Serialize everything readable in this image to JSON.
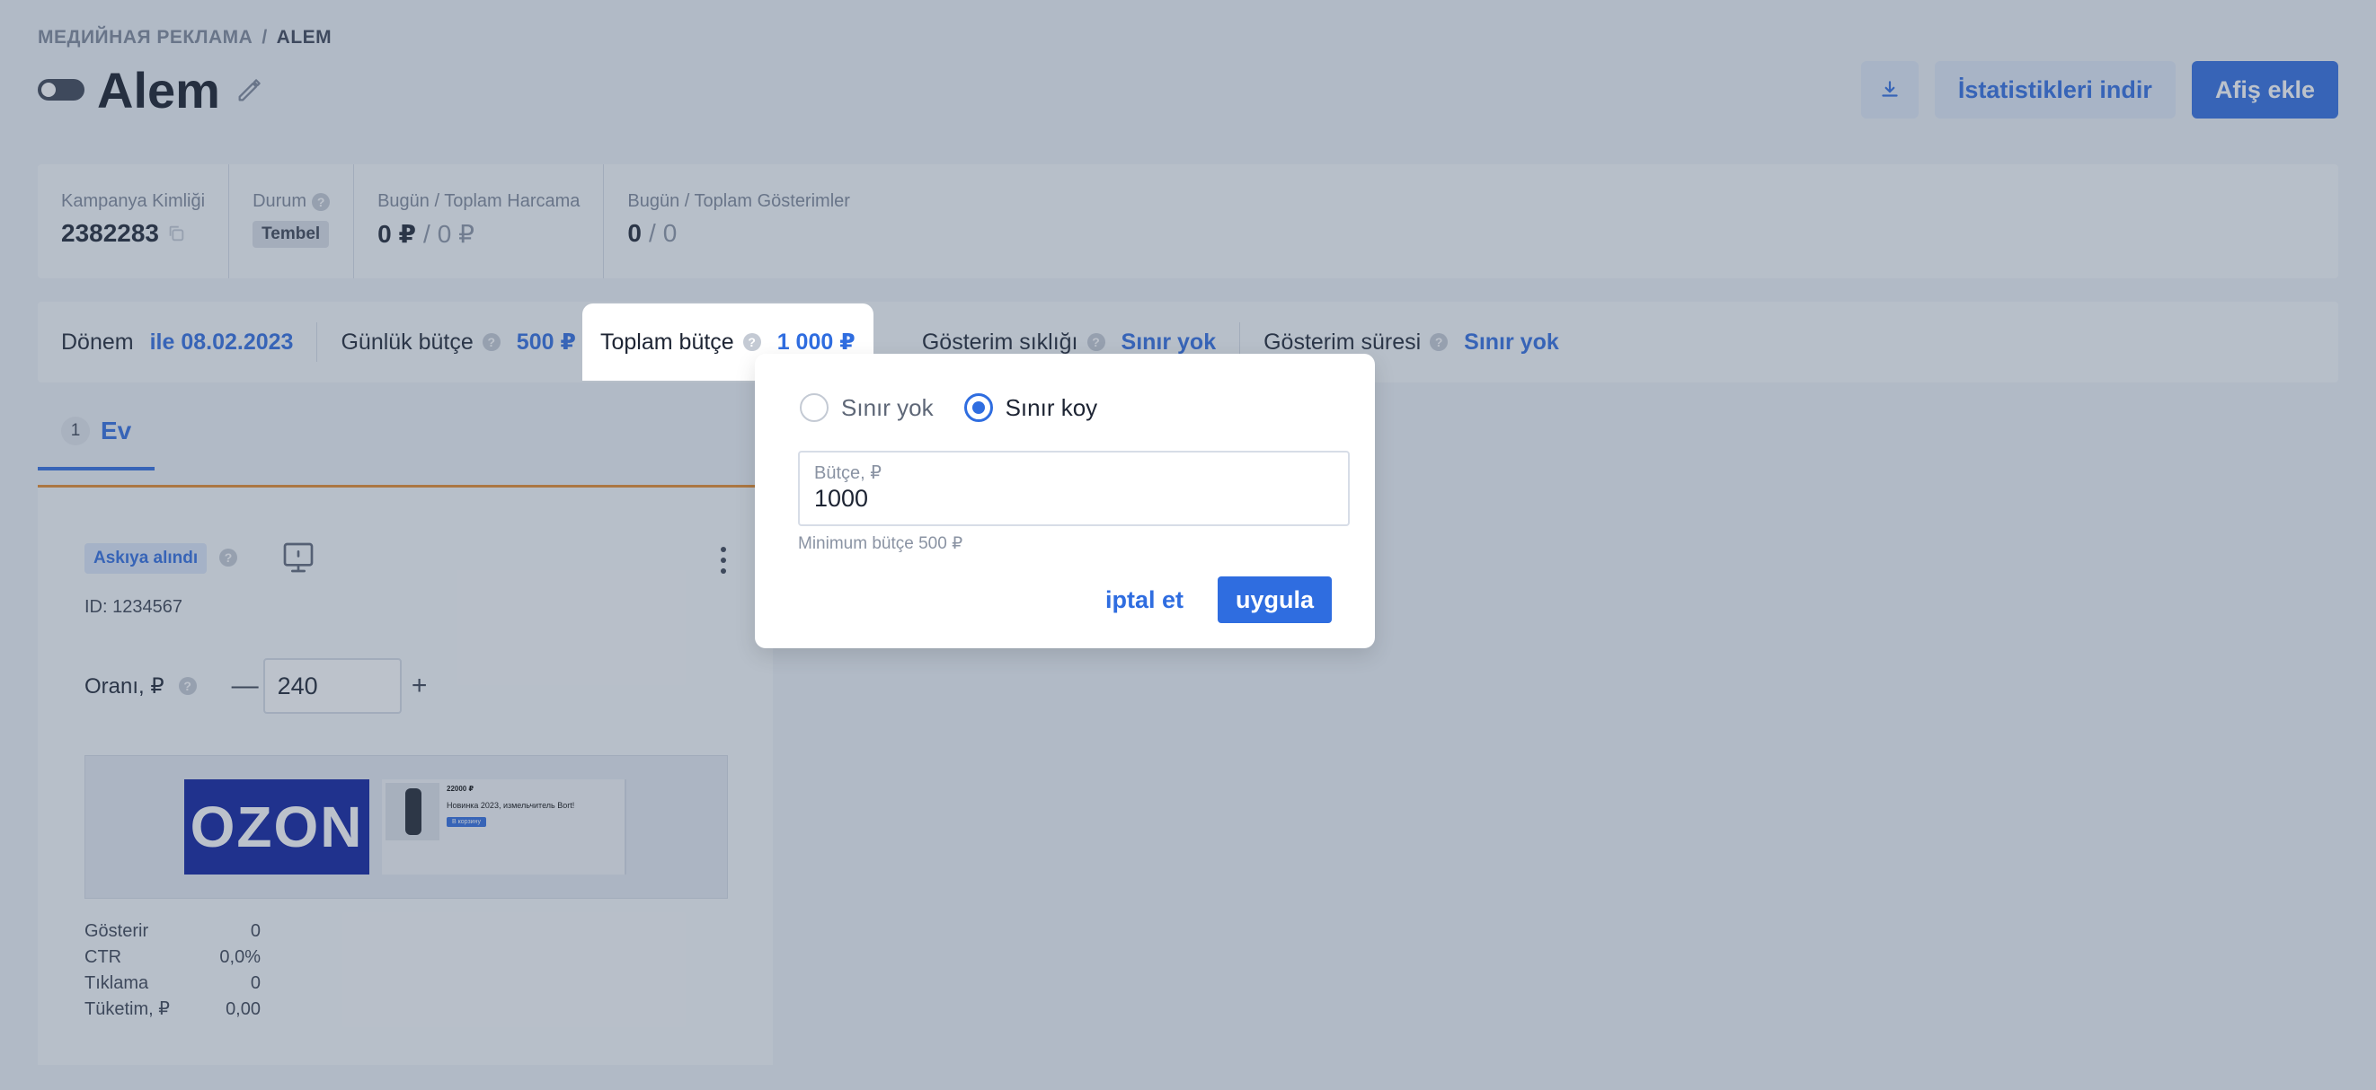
{
  "breadcrumb": {
    "parent": "МЕДИЙНАЯ РЕКЛАМА",
    "separator": "/",
    "current": "ALEM"
  },
  "header": {
    "title": "Alem",
    "stats_button": "İstatistikleri indir",
    "add_button": "Afiş ekle"
  },
  "stats": {
    "campaign_id_label": "Kampanya Kimliği",
    "campaign_id": "2382283",
    "status_label": "Durum",
    "status": "Tembel",
    "spend_label": "Bugün / Toplam Harcama",
    "spend_today": "0 ₽",
    "spend_total": "0 ₽",
    "impressions_label": "Bugün / Toplam Gösterimler",
    "impressions_today": "0",
    "impressions_total": "0",
    "slash": "/"
  },
  "settings": {
    "period_label": "Dönem",
    "period_value": "ile 08.02.2023",
    "daily_label": "Günlük bütçe",
    "daily_value": "500 ₽",
    "total_label": "Toplam bütçe",
    "total_value": "1 000 ₽",
    "frequency_label": "Gösterim sıklığı",
    "frequency_value": "Sınır yok",
    "duration_label": "Gösterim süresi",
    "duration_value": "Sınır yok"
  },
  "tabs": [
    {
      "count": "1",
      "label": "Ev"
    }
  ],
  "ad": {
    "status": "Askıya alındı",
    "id": "ID: 1234567",
    "rate_label": "Oranı, ₽",
    "rate_value": "240",
    "minus": "—",
    "plus": "+",
    "banner_text": "OZON",
    "product_price": "22000 ₽",
    "product_title": "Новинка 2023, измельчитель Bort!",
    "product_button": "В корзину",
    "metrics": [
      {
        "label": "Gösterir",
        "value": "0"
      },
      {
        "label": "CTR",
        "value": "0,0%"
      },
      {
        "label": "Tıklama",
        "value": "0"
      },
      {
        "label": "Tüketim, ₽",
        "value": "0,00"
      }
    ]
  },
  "popover": {
    "option_none": "Sınır yok",
    "option_limit": "Sınır koy",
    "selected": "Sınır koy",
    "budget_label": "Bütçe, ₽",
    "budget_value": "1000",
    "hint": "Minimum bütçe 500 ₽",
    "cancel": "iptal et",
    "apply": "uygula"
  },
  "colors": {
    "accent": "#2f6de0",
    "tab_underline": "#e58a2a",
    "banner": "#0b1f9e"
  },
  "icons": {
    "edit": "pencil-icon",
    "download": "download-icon",
    "help": "question-icon",
    "copy": "copy-icon",
    "device": "monitor-icon",
    "menu": "kebab-menu-icon"
  }
}
